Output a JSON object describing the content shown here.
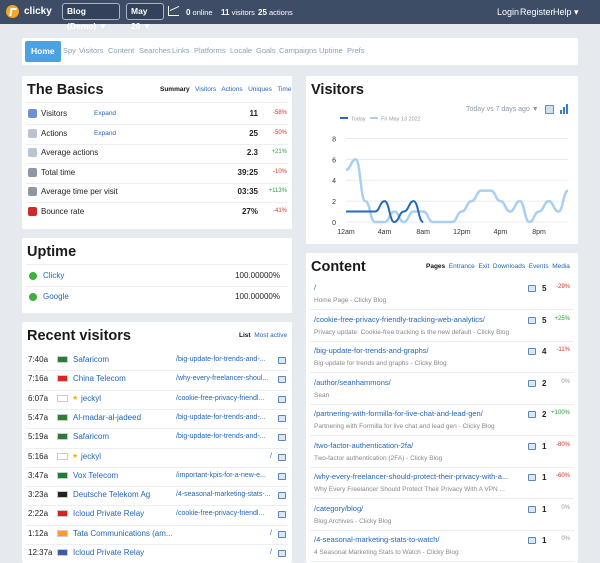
{
  "topbar": {
    "brand": "clicky",
    "site": "Blog (Demo) ▼",
    "date": "May 20 ▼",
    "online_n": "0",
    "online_l": "online",
    "visitors_n": "11",
    "visitors_l": "visitors",
    "actions_n": "25",
    "actions_l": "actions",
    "login": "Login",
    "register": "Register",
    "help": "Help ▾"
  },
  "nav": {
    "home": "Home",
    "tabs": [
      "Spy",
      "Visitors",
      "Content",
      "Searches",
      "Links",
      "Platforms",
      "Locale",
      "Goals",
      "Campaigns",
      "Uptime",
      "Prefs"
    ]
  },
  "basics": {
    "title": "The Basics",
    "tabs": [
      "Summary",
      "Visitors",
      "Actions",
      "Uniques",
      "Time"
    ],
    "rows": [
      {
        "label": "Visitors",
        "link": "Expand",
        "value": "11",
        "change": "-58%"
      },
      {
        "label": "Actions",
        "link": "Expand",
        "value": "25",
        "change": "-50%"
      },
      {
        "label": "Average actions",
        "link": "",
        "value": "2.3",
        "change": "+21%"
      },
      {
        "label": "Total time",
        "link": "",
        "value": "39:25",
        "change": "-10%"
      },
      {
        "label": "Average time per visit",
        "link": "",
        "value": "03:35",
        "change": "+113%"
      },
      {
        "label": "Bounce rate",
        "link": "",
        "value": "27%",
        "change": "-41%"
      }
    ]
  },
  "uptime": {
    "title": "Uptime",
    "rows": [
      {
        "name": "Clicky",
        "value": "100.00000%"
      },
      {
        "name": "Google",
        "value": "100.00000%"
      }
    ]
  },
  "recent": {
    "title": "Recent visitors",
    "tabs": [
      "List",
      "Most active"
    ],
    "rows": [
      {
        "time": "7:40a",
        "name": "Safaricom",
        "page": "/big-update-for-trends-and-..."
      },
      {
        "time": "7:16a",
        "name": "China Telecom",
        "page": "/why-every-freelancer-shoul..."
      },
      {
        "time": "6:07a",
        "name": "jeckyl",
        "page": "/cookie-free-privacy-friendl..."
      },
      {
        "time": "5:47a",
        "name": "Al-madar-al-jadeed",
        "page": "/big-update-for-trends-and-..."
      },
      {
        "time": "5:19a",
        "name": "Safaricom",
        "page": "/big-update-for-trends-and-..."
      },
      {
        "time": "5:16a",
        "name": "jeckyl",
        "page": "/"
      },
      {
        "time": "3:47a",
        "name": "Vox Telecom",
        "page": "/important-kpis-for-a-new-e..."
      },
      {
        "time": "3:23a",
        "name": "Deutsche Telekom Ag",
        "page": "/4-seasonal-marketing-stats-..."
      },
      {
        "time": "2:22a",
        "name": "Icloud Private Relay",
        "page": "/cookie-free-privacy-friendl..."
      },
      {
        "time": "1:12a",
        "name": "Tata Communications (am...",
        "page": "/"
      },
      {
        "time": "12:37a",
        "name": "Icloud Private Relay",
        "page": "/"
      }
    ]
  },
  "visitors": {
    "title": "Visitors",
    "compare": "Today vs 7 days ago ▼",
    "legend": [
      "Today",
      "Fri May 13 2022"
    ]
  },
  "chart_data": {
    "type": "line",
    "x": [
      "12am",
      "1am",
      "2am",
      "3am",
      "4am",
      "5am",
      "6am",
      "7am",
      "8am",
      "9am",
      "10am",
      "11am",
      "12pm",
      "1pm",
      "2pm",
      "3pm",
      "4pm",
      "5pm",
      "6pm",
      "7pm",
      "8pm",
      "9pm",
      "10pm",
      "11pm"
    ],
    "xticks": [
      "12am",
      "4am",
      "8am",
      "12pm",
      "4pm",
      "8pm"
    ],
    "yticks": [
      "0",
      "2",
      "4",
      "6",
      "8"
    ],
    "ylim": [
      0,
      9
    ],
    "series": [
      {
        "name": "Today",
        "color": "#2a6bb5",
        "values": [
          1,
          1,
          1,
          1,
          2,
          0,
          1,
          2,
          0,
          null,
          null,
          null,
          null,
          null,
          null,
          null,
          null,
          null,
          null,
          null,
          null,
          null,
          null,
          null
        ]
      },
      {
        "name": "Fri May 13 2022",
        "color": "#a9d0f0",
        "values": [
          5,
          6,
          2,
          0,
          0,
          1,
          0,
          1,
          1,
          0,
          0,
          0,
          1,
          2,
          3,
          3,
          2,
          1,
          2,
          0,
          1,
          2,
          1,
          3
        ]
      }
    ]
  },
  "content": {
    "title": "Content",
    "tabs": [
      "Pages",
      "Entrance",
      "Exit",
      "Downloads",
      "Events",
      "Media"
    ],
    "rows": [
      {
        "url": "/",
        "desc": "Home Page - Clicky Blog",
        "count": "5",
        "change": "-29%"
      },
      {
        "url": "/cookie-free-privacy-friendly-tracking-web-analytics/",
        "desc": "Privacy update: Cookie-free tracking is the new default - Clicky Blog",
        "count": "5",
        "change": "+25%"
      },
      {
        "url": "/big-update-for-trends-and-graphs/",
        "desc": "Big update for trends and graphs - Clicky Blog",
        "count": "4",
        "change": "-11%"
      },
      {
        "url": "/author/seanhammons/",
        "desc": "Sean",
        "count": "2",
        "change": "0%"
      },
      {
        "url": "/partnering-with-formilla-for-live-chat-and-lead-gen/",
        "desc": "Partnering with Formilla for live chat and lead gen - Clicky Blog",
        "count": "2",
        "change": "+100%"
      },
      {
        "url": "/two-factor-authentication-2fa/",
        "desc": "Two-factor authentication (2FA) - Clicky Blog",
        "count": "1",
        "change": "-80%"
      },
      {
        "url": "/why-every-freelancer-should-protect-their-privacy-with-a...",
        "desc": "Why Every Freelancer Should Protect Their Privacy With A VPN ...",
        "count": "1",
        "change": "-60%"
      },
      {
        "url": "/category/blog/",
        "desc": "Blog Archives - Clicky Blog",
        "count": "1",
        "change": "0%"
      },
      {
        "url": "/4-seasonal-marketing-stats-to-watch/",
        "desc": "4 Seasonal Marketing Stats to Watch - Clicky Blog",
        "count": "1",
        "change": "0%"
      }
    ]
  }
}
